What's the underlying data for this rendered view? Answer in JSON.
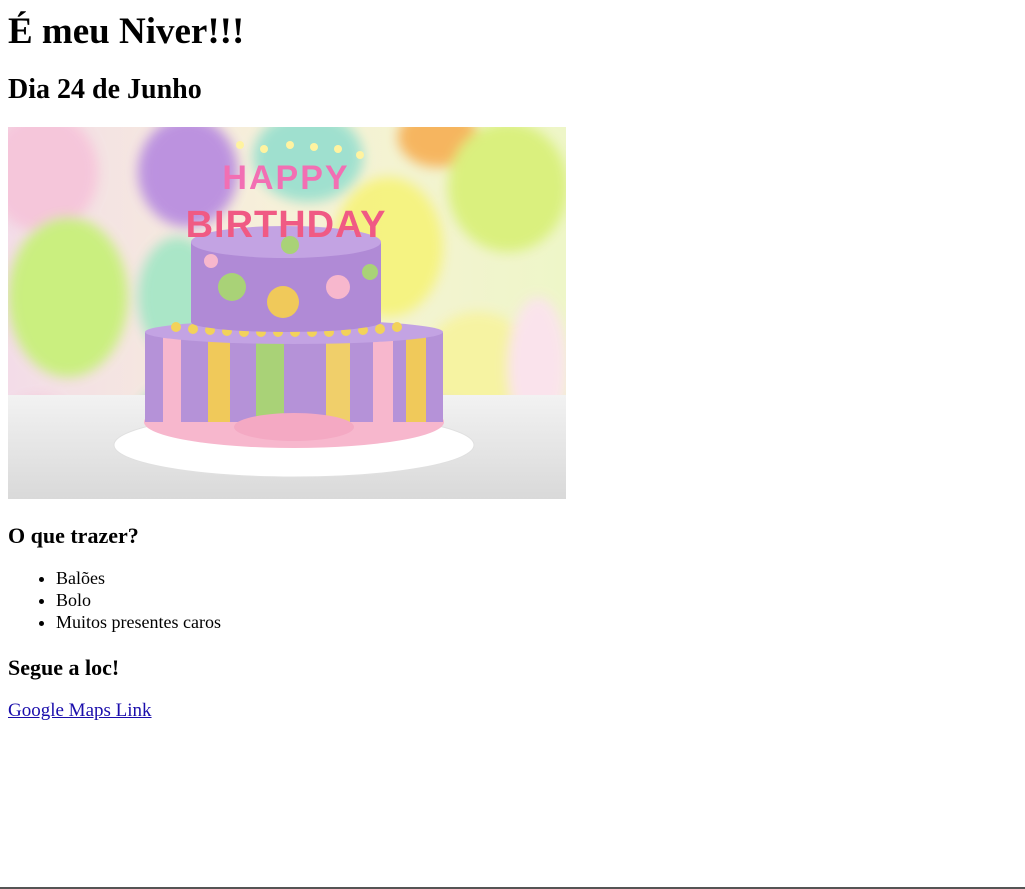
{
  "header": {
    "title": "É meu Niver!!!",
    "date": "Dia 24 de Junho"
  },
  "image": {
    "caption_candles": "HAPPY BIRTHDAY"
  },
  "bring": {
    "heading": "O que trazer?",
    "items": [
      "Balões",
      "Bolo",
      "Muitos presentes caros"
    ]
  },
  "location": {
    "heading": "Segue a loc!",
    "link_text": "Google Maps Link"
  }
}
